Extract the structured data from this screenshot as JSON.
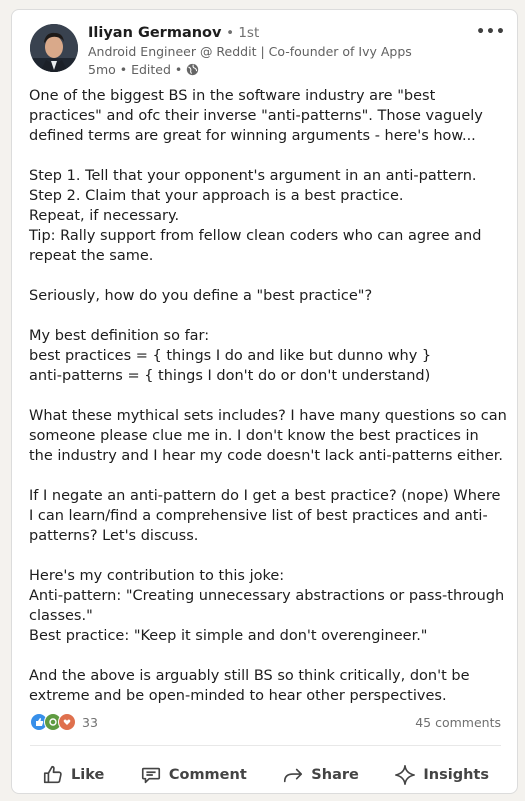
{
  "author": {
    "name": "Iliyan Germanov",
    "degree": "• 1st",
    "headline": "Android Engineer @ Reddit | Co-founder of Ivy Apps",
    "time": "5mo • Edited •"
  },
  "post": {
    "paragraphs": [
      [
        "One of the biggest BS in the software industry are \"best practices\" and ofc their inverse \"anti-patterns\". Those vaguely defined terms are great for winning arguments - here's how..."
      ],
      [
        "Step 1. Tell that your opponent's argument in an anti-pattern.",
        "Step 2. Claim that your approach is a best practice.",
        "Repeat, if necessary.",
        "Tip: Rally support from fellow clean coders who can agree and repeat the same."
      ],
      [
        "Seriously, how do you define a \"best practice\"?"
      ],
      [
        "My best definition so far:",
        "best practices = { things I do and like but dunno why }",
        "anti-patterns = { things I don't do or don't understand)"
      ],
      [
        "What these mythical sets includes? I have many questions so can someone please clue me in. I don't know the best practices in the industry and I hear my code doesn't lack anti-patterns either."
      ],
      [
        "If I negate an anti-pattern do I get a best practice? (nope) Where I can learn/find a comprehensive list of best practices and anti-patterns? Let's discuss."
      ],
      [
        "Here's my contribution to this joke:",
        "Anti-pattern: \"Creating unnecessary abstractions or pass-through classes.\"",
        "Best practice: \"Keep it simple and don't overengineer.\""
      ],
      [
        "And the above is arguably still BS so think critically, don't be extreme and be open-minded to hear other perspectives."
      ]
    ]
  },
  "social": {
    "reaction_count": "33",
    "comments": "45 comments"
  },
  "actions": {
    "like": "Like",
    "comment": "Comment",
    "share": "Share",
    "insights": "Insights"
  },
  "colors": {
    "like_blue": "#378fe9",
    "celebrate_green": "#5f9b41",
    "support_orange": "#df704d"
  }
}
